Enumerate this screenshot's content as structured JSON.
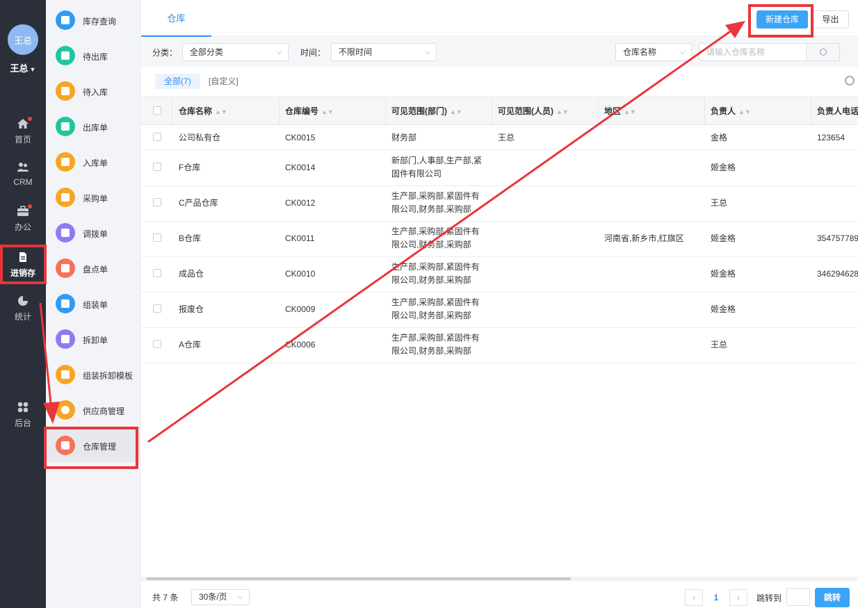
{
  "user": {
    "avatar_text": "王总",
    "name": "王总"
  },
  "nav": {
    "items": [
      {
        "label": "首页",
        "icon": "home-icon",
        "badge": true
      },
      {
        "label": "CRM",
        "icon": "crm-icon",
        "badge": false
      },
      {
        "label": "办公",
        "icon": "briefcase-icon",
        "badge": true
      },
      {
        "label": "进销存",
        "icon": "inventory-icon",
        "badge": false,
        "active": true
      },
      {
        "label": "统计",
        "icon": "pie-chart-icon",
        "badge": false
      },
      {
        "label": "后台",
        "icon": "admin-icon",
        "badge": false
      }
    ]
  },
  "submenu": {
    "items": [
      {
        "label": "库存查询",
        "color": "#2f9cf3"
      },
      {
        "label": "待出库",
        "color": "#22c5a0"
      },
      {
        "label": "待入库",
        "color": "#f6a623"
      },
      {
        "label": "出库单",
        "color": "#22c5a0"
      },
      {
        "label": "入库单",
        "color": "#f6a623"
      },
      {
        "label": "采购单",
        "color": "#f6a623"
      },
      {
        "label": "调拨单",
        "color": "#8c7cf2"
      },
      {
        "label": "盘点单",
        "color": "#f7725a"
      },
      {
        "label": "组装单",
        "color": "#2f9cf3"
      },
      {
        "label": "拆卸单",
        "color": "#8c7cf2"
      },
      {
        "label": "组装拆卸模板",
        "color": "#f6a623"
      },
      {
        "label": "供应商管理",
        "color": "#f6a623"
      },
      {
        "label": "仓库管理",
        "color": "#f7725a",
        "active": true
      }
    ]
  },
  "tabs": {
    "active": "仓库"
  },
  "toolbar": {
    "new_label": "新建仓库",
    "export_label": "导出"
  },
  "filters": {
    "category_label": "分类：",
    "category_value": "全部分类",
    "time_label": "时间：",
    "time_value": "不限时间",
    "search_field": "仓库名称",
    "search_placeholder": "请输入仓库名称"
  },
  "view_tabs": {
    "all": "全部(7)",
    "custom": "[自定义]"
  },
  "table": {
    "columns": [
      "仓库名称",
      "仓库编号",
      "可见范围(部门)",
      "可见范围(人员)",
      "地区",
      "负责人",
      "负责人电话"
    ],
    "rows": [
      {
        "name": "公司私有仓",
        "code": "CK0015",
        "dept": "财务部",
        "staff": "王总",
        "region": "",
        "owner": "金格",
        "phone": "123654"
      },
      {
        "name": "F仓库",
        "code": "CK0014",
        "dept": "新部门,人事部,生产部,紧固件有限公司",
        "staff": "",
        "region": "",
        "owner": "姬金格",
        "phone": ""
      },
      {
        "name": "C产品仓库",
        "code": "CK0012",
        "dept": "生产部,采购部,紧固件有限公司,财务部,采购部",
        "staff": "",
        "region": "",
        "owner": "王总",
        "phone": ""
      },
      {
        "name": "B仓库",
        "code": "CK0011",
        "dept": "生产部,采购部,紧固件有限公司,财务部,采购部",
        "staff": "",
        "region": "河南省,新乡市,红旗区",
        "owner": "姬金格",
        "phone": "354757789"
      },
      {
        "name": "成品仓",
        "code": "CK0010",
        "dept": "生产部,采购部,紧固件有限公司,财务部,采购部",
        "staff": "",
        "region": "",
        "owner": "姬金格",
        "phone": "346294628"
      },
      {
        "name": "报废仓",
        "code": "CK0009",
        "dept": "生产部,采购部,紧固件有限公司,财务部,采购部",
        "staff": "",
        "region": "",
        "owner": "姬金格",
        "phone": ""
      },
      {
        "name": "A仓库",
        "code": "CK0006",
        "dept": "生产部,采购部,紧固件有限公司,财务部,采购部",
        "staff": "",
        "region": "",
        "owner": "王总",
        "phone": ""
      }
    ]
  },
  "pagination": {
    "total": "共 7 条",
    "page_size": "30条/页",
    "prev": "‹",
    "current": "1",
    "next": "›",
    "jump_label": "跳转到",
    "jump_button": "跳转"
  },
  "colors": {
    "accent": "#2d8cf0",
    "annotation": "#e8363a",
    "nav_bg": "#2a2f3a"
  }
}
